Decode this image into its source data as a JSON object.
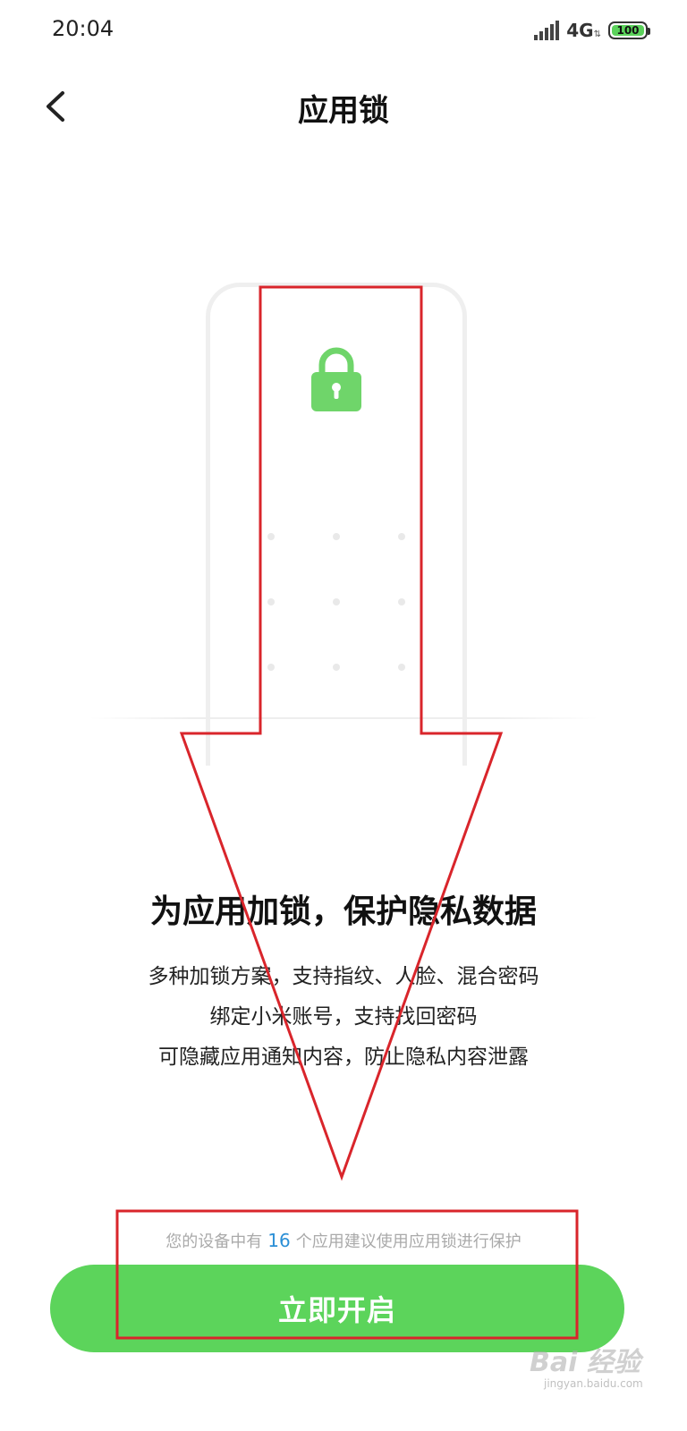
{
  "status_bar": {
    "time": "20:04",
    "network": "4G",
    "battery": "100"
  },
  "header": {
    "title": "应用锁",
    "back_icon": "chevron-left-icon"
  },
  "illustration": {
    "icon": "lock-icon",
    "accent_color": "#5cd45b"
  },
  "main": {
    "headline": "为应用加锁，保护隐私数据",
    "description": [
      "多种加锁方案，支持指纹、人脸、混合密码",
      "绑定小米账号，支持找回密码",
      "可隐藏应用通知内容，防止隐私内容泄露"
    ]
  },
  "suggestion": {
    "prefix": "您的设备中有",
    "count": "16",
    "suffix": "个应用建议使用应用锁进行保护"
  },
  "enable_button": {
    "label": "立即开启",
    "color": "#5cd45b"
  },
  "annotation": {
    "color": "#d9252b"
  },
  "watermark": {
    "main": "Bai 经验",
    "sub": "jingyan.baidu.com"
  }
}
